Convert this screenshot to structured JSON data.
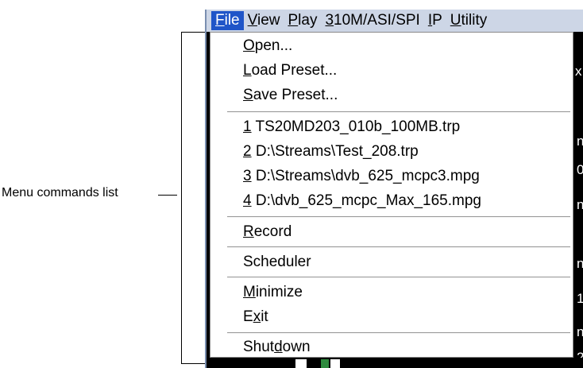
{
  "callout": {
    "label": "Menu commands list"
  },
  "menubar": {
    "items": [
      {
        "mnemonic": "F",
        "rest": "ile"
      },
      {
        "mnemonic": "V",
        "rest": "iew"
      },
      {
        "mnemonic": "P",
        "rest": "lay"
      },
      {
        "mnemonic": "3",
        "rest": "10M/ASI/SPI"
      },
      {
        "mnemonic": "I",
        "rest": "P"
      },
      {
        "mnemonic": "U",
        "rest": "tility"
      }
    ]
  },
  "file_menu": {
    "open": {
      "mn": "O",
      "rest": "pen..."
    },
    "load_preset": {
      "mn": "L",
      "rest": "oad Preset..."
    },
    "save_preset": {
      "mn": "S",
      "rest": "ave Preset..."
    },
    "recent": [
      {
        "mn": "1",
        "rest": " TS20MD203_010b_100MB.trp"
      },
      {
        "mn": "2",
        "rest": " D:\\Streams\\Test_208.trp"
      },
      {
        "mn": "3",
        "rest": " D:\\Streams\\dvb_625_mcpc3.mpg"
      },
      {
        "mn": "4",
        "rest": " D:\\dvb_625_mcpc_Max_165.mpg"
      }
    ],
    "record": {
      "mn": "R",
      "rest": "ecord"
    },
    "scheduler": {
      "label": "Scheduler"
    },
    "minimize": {
      "mn": "M",
      "rest": "inimize"
    },
    "exit": {
      "pre": "E",
      "mn": "x",
      "rest": "it"
    },
    "shutdown": {
      "pre": "Shut",
      "mn": "d",
      "rest": "own"
    }
  },
  "background": {
    "fragments": [
      "x",
      "n",
      "0",
      "n",
      "n",
      "1",
      "n",
      "2"
    ]
  }
}
